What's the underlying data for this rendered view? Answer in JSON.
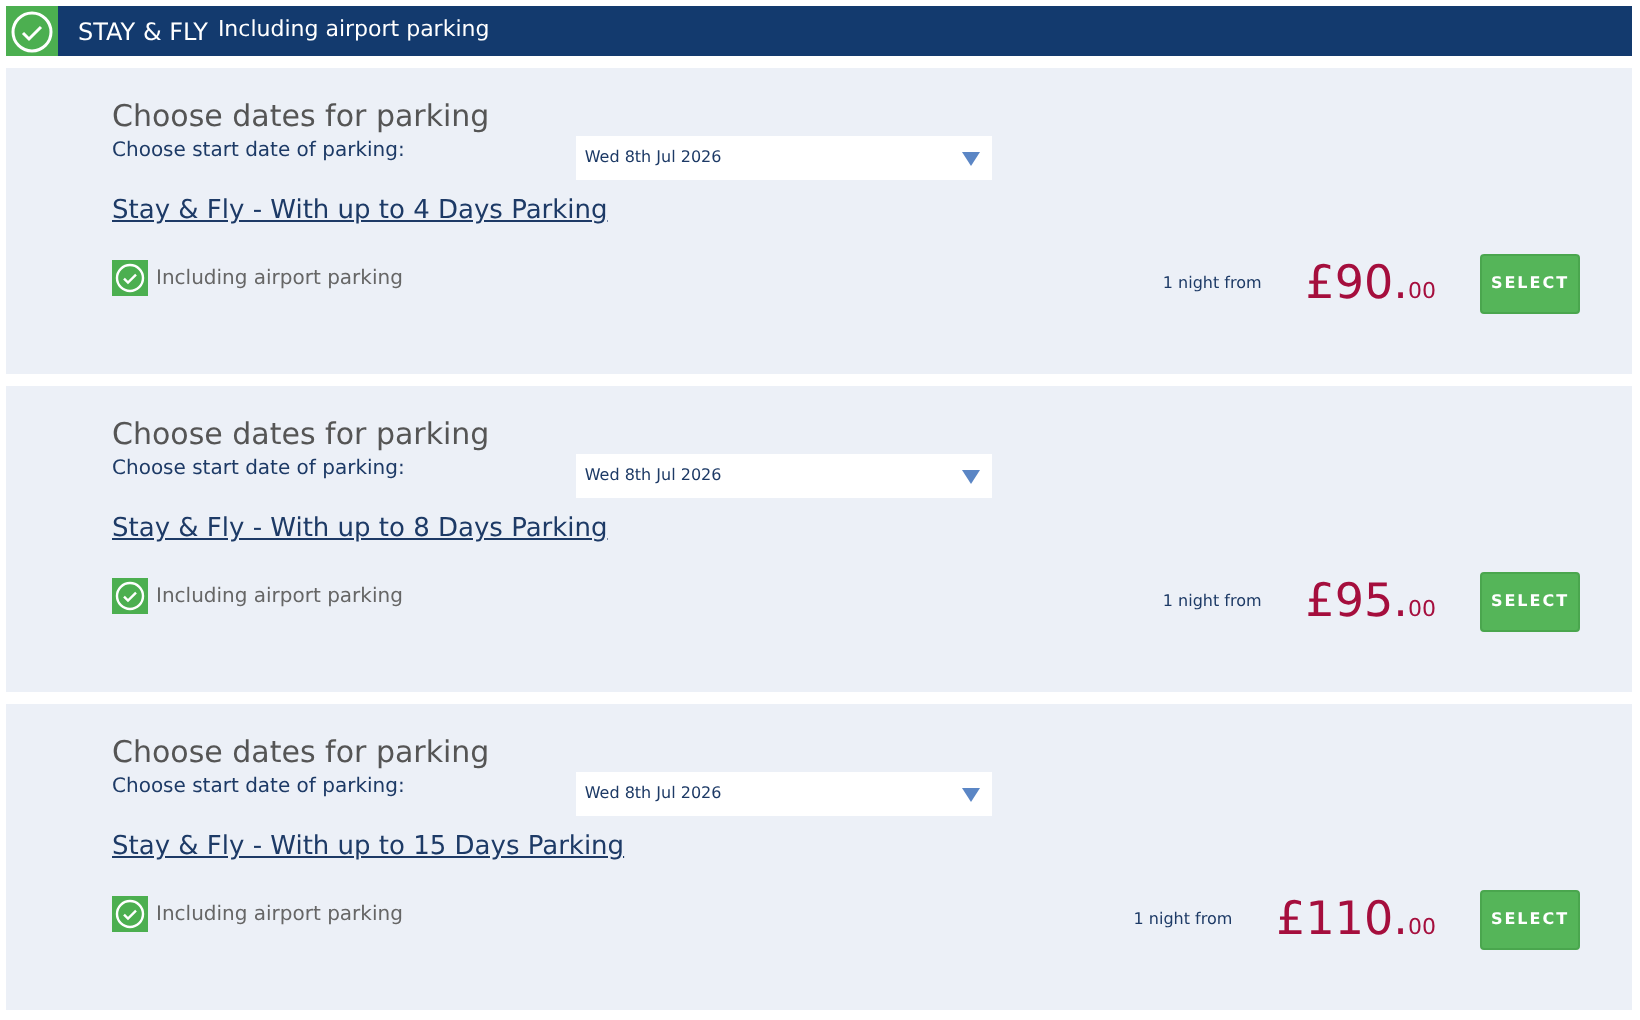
{
  "header": {
    "title": "STAY & FLY",
    "subtitle": "Including airport parking"
  },
  "offers": [
    {
      "heading": "Choose dates for parking",
      "date_label": "Choose start date of parking:",
      "date_value": "Wed 8th Jul 2026",
      "name": "Stay & Fly - With up to 4 Days Parking",
      "feature": "Including airport parking",
      "from_label": "1 night from",
      "price": "£90.",
      "price_cents": "00",
      "button": "SELECT"
    },
    {
      "heading": "Choose dates for parking",
      "date_label": "Choose start date of parking:",
      "date_value": "Wed 8th Jul 2026",
      "name": "Stay & Fly - With up to 8 Days Parking",
      "feature": "Including airport parking",
      "from_label": "1 night from",
      "price": "£95.",
      "price_cents": "00",
      "button": "SELECT"
    },
    {
      "heading": "Choose dates for parking",
      "date_label": "Choose start date of parking:",
      "date_value": "Wed 8th Jul 2026",
      "name": "Stay & Fly - With up to 15 Days Parking",
      "feature": "Including airport parking",
      "from_label": "1 night from",
      "price": "£110.",
      "price_cents": "00",
      "button": "SELECT"
    }
  ]
}
